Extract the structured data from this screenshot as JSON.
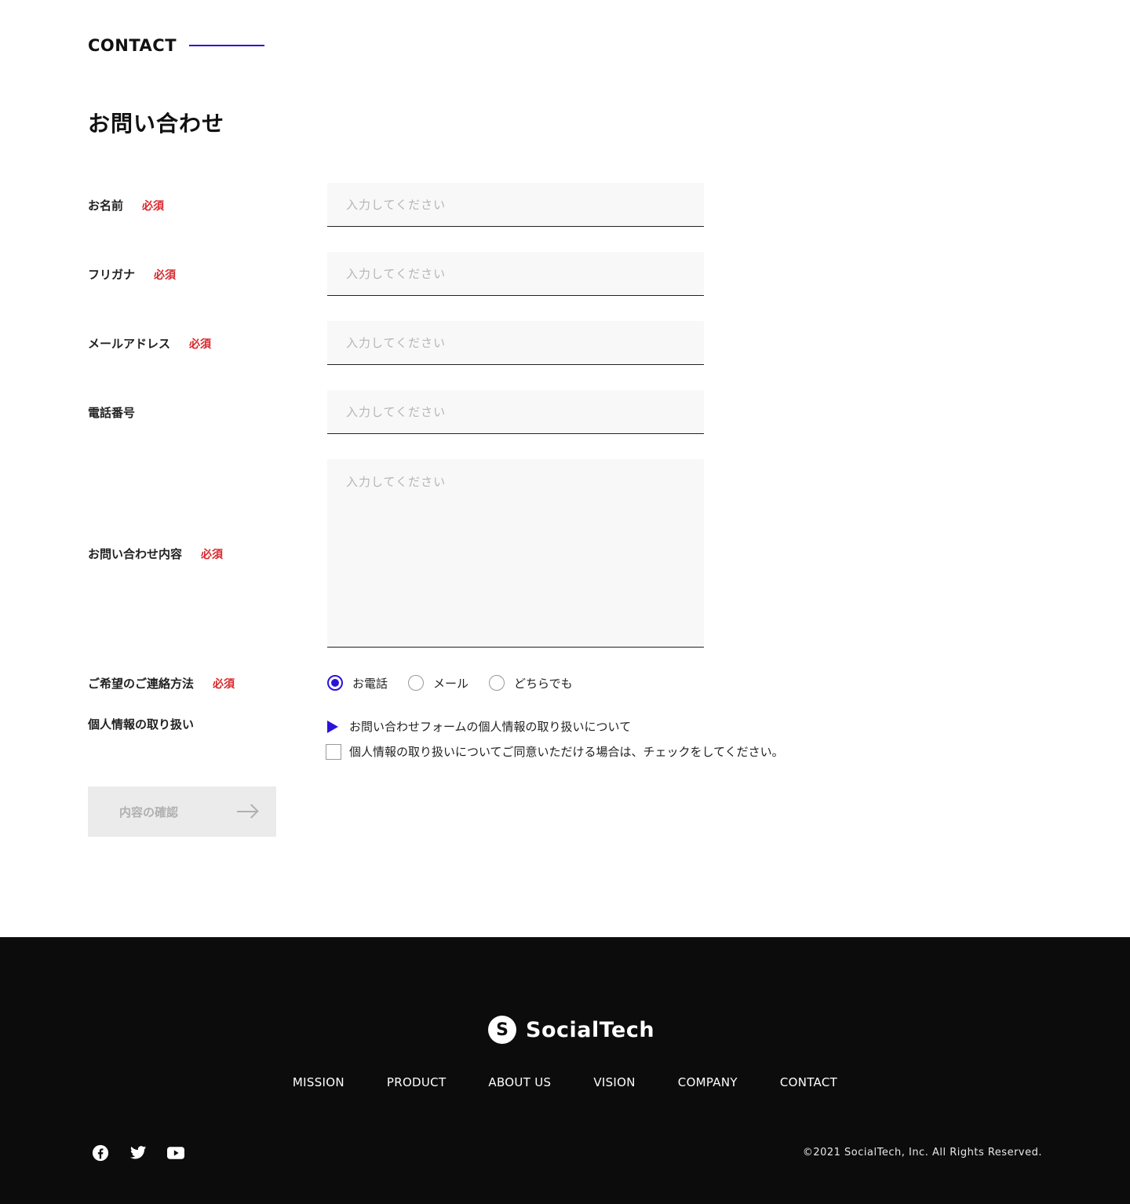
{
  "section": {
    "label": "CONTACT"
  },
  "page": {
    "title": "お問い合わせ"
  },
  "form": {
    "required_label": "必須",
    "placeholder": "入力してください",
    "fields": [
      {
        "label": "お名前",
        "required": true
      },
      {
        "label": "フリガナ",
        "required": true
      },
      {
        "label": "メールアドレス",
        "required": true
      },
      {
        "label": "電話番号",
        "required": false
      },
      {
        "label": "お問い合わせ内容",
        "required": true
      }
    ],
    "contact_method": {
      "label": "ご希望のご連絡方法",
      "options": [
        "お電話",
        "メール",
        "どちらでも"
      ],
      "selected": "お電話"
    },
    "privacy": {
      "label": "個人情報の取り扱い",
      "link_text": "お問い合わせフォームの個人情報の取り扱いについて",
      "consent_text": "個人情報の取り扱いについてご同意いただける場合は、チェックをしてください。",
      "checked": false
    },
    "confirm_button": "内容の確認"
  },
  "footer": {
    "logo_text": "SocialTech",
    "logo_mark": "S",
    "nav": [
      "MISSION",
      "PRODUCT",
      "ABOUT US",
      "VISION",
      "COMPANY",
      "CONTACT"
    ],
    "social": [
      "facebook-icon",
      "twitter-icon",
      "youtube-icon"
    ],
    "copyright": "©2021 SocialTech, Inc. All Rights Reserved."
  },
  "colors": {
    "accent": "#2a14d9",
    "required": "#d8262b",
    "footer_bg": "#0c0c0c",
    "input_bg": "#f8f8f8",
    "button_disabled_bg": "#ebebeb"
  }
}
